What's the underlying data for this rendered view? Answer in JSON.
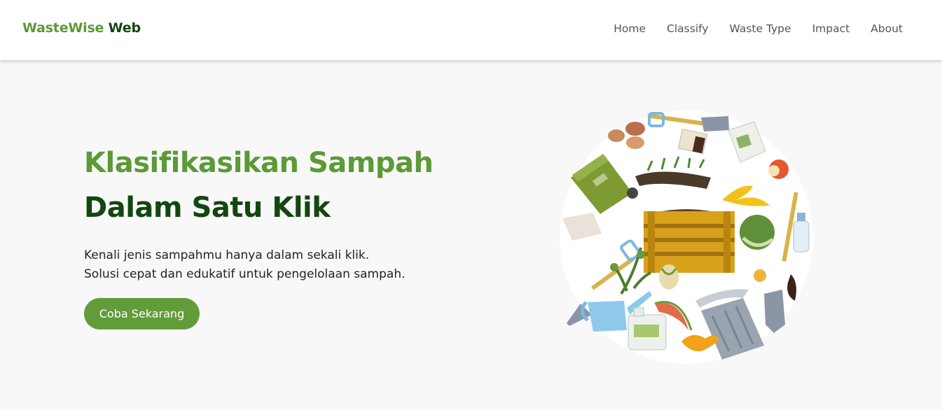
{
  "navbar": {
    "brand_part1": "WasteWise",
    "brand_part2": "Web",
    "links": [
      "Home",
      "Classify",
      "Waste Type",
      "Impact",
      "About"
    ]
  },
  "hero": {
    "title_line1": "Klasifikasikan Sampah",
    "title_line2": "Dalam Satu Klik",
    "desc_line1": "Kenali jenis sampahmu hanya dalam sekali klik.",
    "desc_line2": "Solusi cepat dan edukatif untuk pengelolaan sampah.",
    "cta_label": "Coba Sekarang"
  },
  "colors": {
    "brand_light": "#5b9a36",
    "brand_dark": "#12470f",
    "button": "#629c3a",
    "hero_bg": "#f8f8f8"
  }
}
